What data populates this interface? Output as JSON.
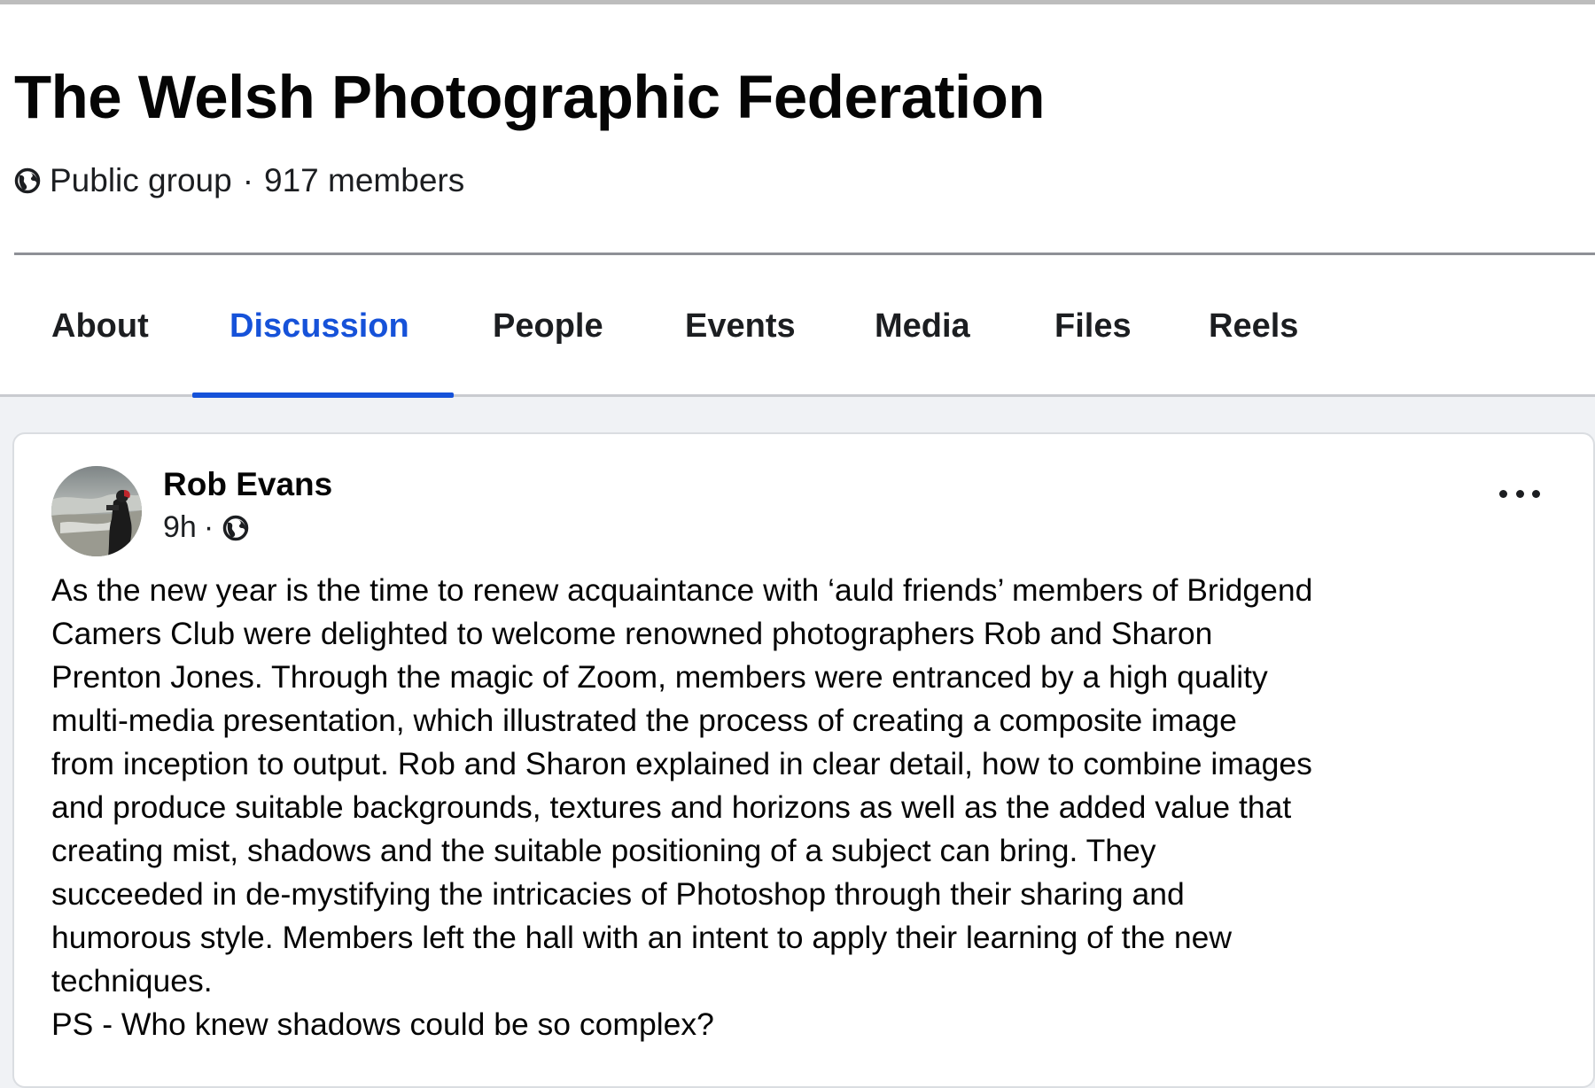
{
  "group": {
    "title": "The Welsh Photographic Federation",
    "privacy": "Public group",
    "separator": "·",
    "members": "917 members"
  },
  "tabs": [
    {
      "label": "About",
      "active": false
    },
    {
      "label": "Discussion",
      "active": true
    },
    {
      "label": "People",
      "active": false
    },
    {
      "label": "Events",
      "active": false
    },
    {
      "label": "Media",
      "active": false
    },
    {
      "label": "Files",
      "active": false
    },
    {
      "label": "Reels",
      "active": false
    }
  ],
  "post": {
    "author": "Rob Evans",
    "time": "9h",
    "time_separator": "·",
    "lines": [
      "As the new year is the time to renew acquaintance with ‘auld friends’ members of Bridgend",
      "Camers Club were delighted to welcome renowned photographers Rob and Sharon",
      "Prenton Jones. Through the magic of Zoom, members were entranced by a high quality",
      "multi-media presentation, which illustrated the process of creating a composite image",
      "from inception to output. Rob and Sharon explained in clear detail, how to combine images",
      "and produce suitable backgrounds, textures and horizons as well as the added value that",
      "creating mist, shadows and the suitable positioning of a subject can bring. They",
      "succeeded in de-mystifying the intricacies of Photoshop through their sharing and",
      "humorous style. Members left the hall with an intent to apply their learning of the new",
      "techniques.",
      "PS - Who knew shadows could be so complex?"
    ]
  },
  "colors": {
    "accent": "#1652d9",
    "page_bg": "#f0f2f5",
    "text": "#050505"
  },
  "icons": {
    "privacy": "globe-icon",
    "audience": "globe-icon",
    "more": "more-options-icon"
  }
}
